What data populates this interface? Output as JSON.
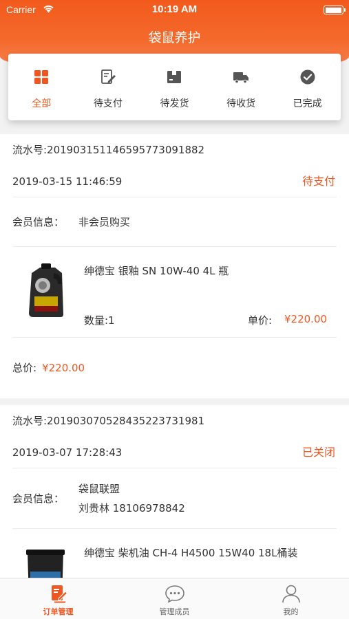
{
  "status_bar": {
    "carrier": "Carrier",
    "time": "10:19 AM",
    "battery_level": 0.9
  },
  "nav": {
    "title": "袋鼠养护"
  },
  "tabs": [
    {
      "label": "全部",
      "icon": "grid-icon",
      "active": true
    },
    {
      "label": "待支付",
      "icon": "edit-doc-icon",
      "active": false
    },
    {
      "label": "待发货",
      "icon": "package-box-icon",
      "active": false
    },
    {
      "label": "待收货",
      "icon": "truck-icon",
      "active": false
    },
    {
      "label": "已完成",
      "icon": "check-circle-icon",
      "active": false
    }
  ],
  "orders": [
    {
      "serial": "流水号:20190315114659577309188​2",
      "time": "2019-03-15 11:46:59",
      "status": "待支付",
      "member_label": "会员信息：",
      "member_lines": [
        "非会员购买"
      ],
      "product": {
        "name": "绅德宝 银釉 SN 10W-40 4L 瓶",
        "qty": "数量:1",
        "price_label": "单价:",
        "price": "¥220.00"
      },
      "total_label": "总价:",
      "total_value": "¥220.00"
    },
    {
      "serial": "流水号:20190307052843522373198​1",
      "time": "2019-03-07 17:28:43",
      "status": "已关闭",
      "member_label": "会员信息：",
      "member_lines": [
        "袋鼠联盟",
        "刘贵林 18106978842"
      ],
      "product": {
        "name": "绅德宝 柴机油 CH-4 H4500 15W40 18L桶装"
      }
    }
  ],
  "tabbar": [
    {
      "label": "订单管理",
      "icon": "order-edit-icon",
      "active": true
    },
    {
      "label": "管理成员",
      "icon": "chat-bubble-icon",
      "active": false
    },
    {
      "label": "我的",
      "icon": "person-icon",
      "active": false
    }
  ],
  "colors": {
    "accent": "#ef5722",
    "header": "#f25a1c"
  }
}
